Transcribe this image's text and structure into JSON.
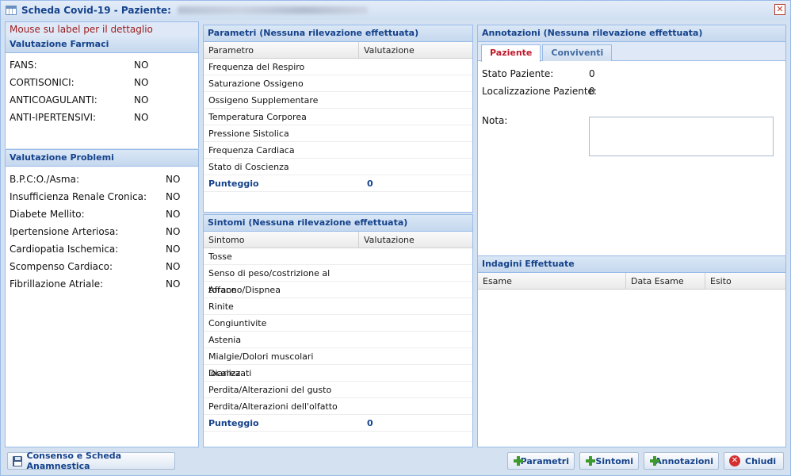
{
  "window": {
    "title": "Scheda Covid-19 - Paziente:"
  },
  "left": {
    "hint": "Mouse su label per il dettaglio",
    "farmaci": {
      "header": "Valutazione Farmaci",
      "items": [
        {
          "label": "FANS:",
          "value": "NO"
        },
        {
          "label": "CORTISONICI:",
          "value": "NO"
        },
        {
          "label": "ANTICOAGULANTI:",
          "value": "NO"
        },
        {
          "label": "ANTI-IPERTENSIVI:",
          "value": "NO"
        }
      ]
    },
    "problemi": {
      "header": "Valutazione Problemi",
      "items": [
        {
          "label": "B.P.C:O./Asma:",
          "value": "NO"
        },
        {
          "label": "Insufficienza Renale Cronica:",
          "value": "NO"
        },
        {
          "label": "Diabete Mellito:",
          "value": "NO"
        },
        {
          "label": "Ipertensione Arteriosa:",
          "value": "NO"
        },
        {
          "label": "Cardiopatia Ischemica:",
          "value": "NO"
        },
        {
          "label": "Scompenso Cardiaco:",
          "value": "NO"
        },
        {
          "label": "Fibrillazione Atriale:",
          "value": "NO"
        }
      ]
    }
  },
  "parametri": {
    "header": "Parametri (Nessuna rilevazione effettuata)",
    "columns": [
      "Parametro",
      "Valutazione"
    ],
    "rows": [
      "Frequenza del Respiro",
      "Saturazione Ossigeno",
      "Ossigeno Supplementare",
      "Temperatura Corporea",
      "Pressione Sistolica",
      "Frequenza Cardiaca",
      "Stato di Coscienza"
    ],
    "total_label": "Punteggio",
    "total_value": "0"
  },
  "sintomi": {
    "header": "Sintomi (Nessuna rilevazione effettuata)",
    "columns": [
      "Sintomo",
      "Valutazione"
    ],
    "rows": [
      "Tosse",
      "Senso di peso/costrizione al torace",
      "Affanno/Dispnea",
      "Rinite",
      "Congiuntivite",
      "Astenia",
      "Mialgie/Dolori muscolari localizzati",
      "Diarrea",
      "Perdita/Alterazioni del gusto",
      "Perdita/Alterazioni dell'olfatto"
    ],
    "total_label": "Punteggio",
    "total_value": "0"
  },
  "annotazioni": {
    "header": "Annotazioni (Nessuna rilevazione effettuata)",
    "tabs": [
      "Paziente",
      "Conviventi"
    ],
    "stato_label": "Stato Paziente:",
    "stato_value": "0",
    "local_label": "Localizzazione Paziente:",
    "local_value": "0",
    "nota_label": "Nota:",
    "nota_value": ""
  },
  "indagini": {
    "header": "Indagini Effettuate",
    "columns": [
      "Esame",
      "Data Esame",
      "Esito"
    ]
  },
  "footer": {
    "consenso": "Consenso e Scheda Anamnestica",
    "parametri": "Parametri",
    "sintomi": "Sintomi",
    "annotazioni": "Annotazioni",
    "chiudi": "Chiudi"
  },
  "icons": {
    "title": "grid-icon",
    "close": "close-icon",
    "consenso": "floppy-disk-icon",
    "add": "plus-icon",
    "chiudi": "close-circle-icon"
  }
}
